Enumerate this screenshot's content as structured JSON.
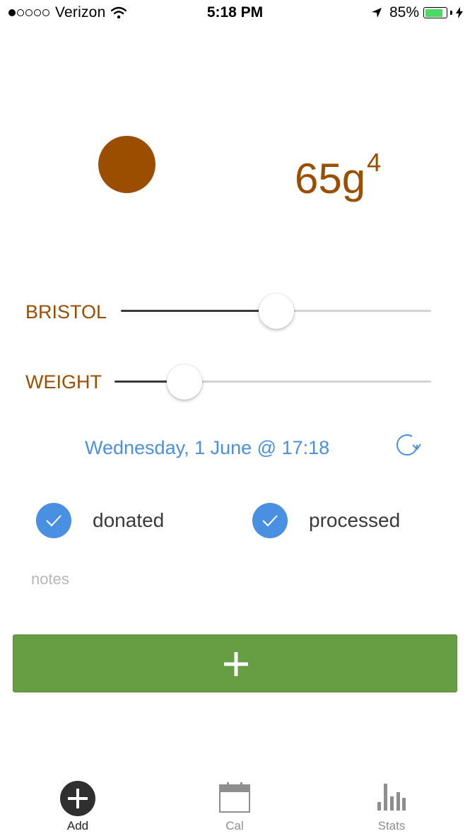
{
  "status_bar": {
    "carrier": "Verizon",
    "time": "5:18 PM",
    "battery_percent": "85%",
    "signal_bars_filled": 1,
    "signal_bars_total": 5,
    "battery_level": 0.85
  },
  "display": {
    "color": "#9b4d00",
    "weight": "65g",
    "bristol_superscript": "4"
  },
  "sliders": {
    "bristol": {
      "label": "BRISTOL",
      "value_fraction": 0.5
    },
    "weight": {
      "label": "WEIGHT",
      "value_fraction": 0.22
    }
  },
  "date": {
    "text": "Wednesday, 1 June @ 17:18",
    "color": "#4a90e2"
  },
  "checkboxes": [
    {
      "label": "donated",
      "checked": true
    },
    {
      "label": "processed",
      "checked": true
    }
  ],
  "notes": {
    "placeholder": "notes"
  },
  "add_button": {
    "color": "#679e43",
    "icon": "plus-icon"
  },
  "tabs": [
    {
      "label": "Add",
      "icon": "add-circle-icon",
      "active": true
    },
    {
      "label": "Cal",
      "icon": "calendar-icon",
      "active": false
    },
    {
      "label": "Stats",
      "icon": "bar-chart-icon",
      "active": false
    }
  ]
}
